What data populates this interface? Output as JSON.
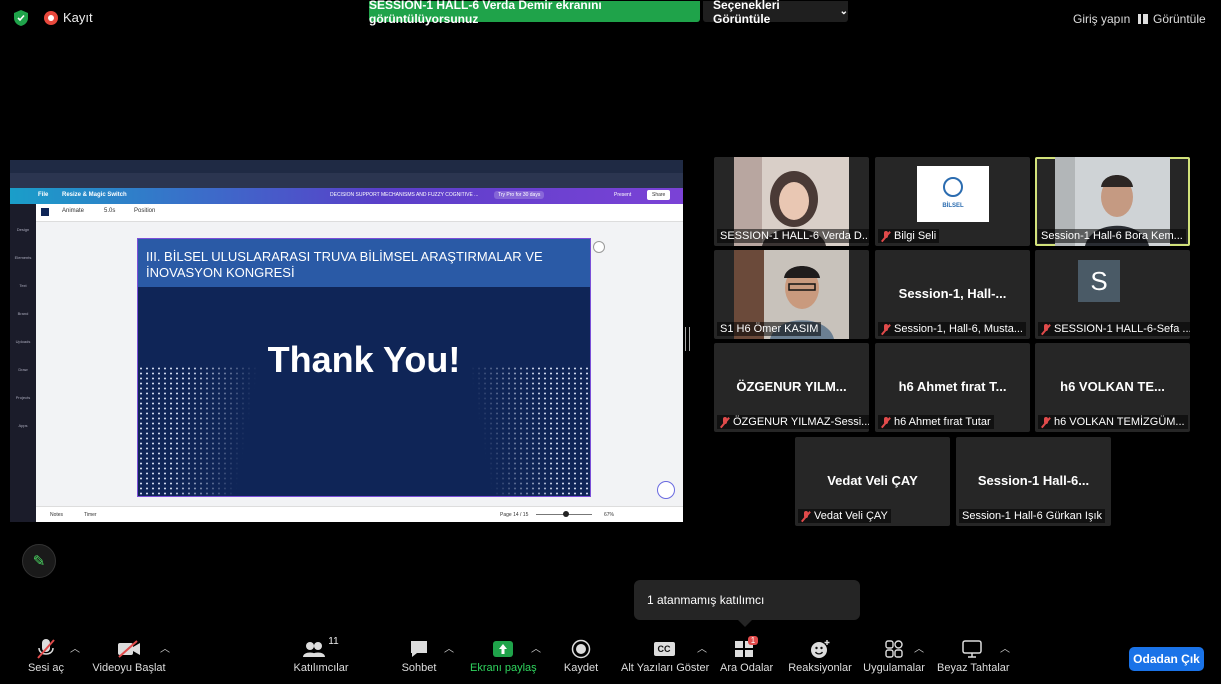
{
  "top": {
    "recording_label": "Kayıt",
    "share_banner": "SESSION-1 HALL-6 Verda Demir ekranını görüntülüyorsunuz",
    "view_options": "Seçenekleri Görüntüle",
    "sign_in": "Giriş yapın",
    "view": "Görüntüle"
  },
  "shared_screen": {
    "doc_title": "DECISION SUPPORT MECHANISMS AND FUZZY COGNITIVE ...",
    "try_pro": "Try Pro for 30 days",
    "present": "Present",
    "share": "Share",
    "file": "File",
    "resize": "Resize & Magic Switch",
    "animate": "Animate",
    "duration": "5.0s",
    "position": "Position",
    "slide_title": "III. BİLSEL ULUSLARARASI TRUVA BİLİMSEL ARAŞTIRMALAR VE İNOVASYON KONGRESİ",
    "slide_text": "Thank You!",
    "notes": "Notes",
    "timer": "Timer",
    "page": "Page 14 / 15",
    "zoom": "67%",
    "sidebar": [
      "Design",
      "Elements",
      "Text",
      "Brand",
      "Uploads",
      "Draw",
      "Projects",
      "Apps"
    ]
  },
  "tiles": [
    {
      "name": "SESSION-1 HALL-6 Verda D...",
      "center": "",
      "muted": false
    },
    {
      "name": "Bilgi Seli",
      "center": "",
      "muted": true,
      "logo_text": "BİLSEL"
    },
    {
      "name": "Session-1 Hall-6 Bora Kem...",
      "center": "",
      "muted": false
    },
    {
      "name": "S1 H6 Ömer KASIM",
      "center": "",
      "muted": false
    },
    {
      "name": "Session-1, Hall-6, Musta...",
      "center": "Session-1,  Hall-...",
      "muted": true
    },
    {
      "name": "SESSION-1 HALL-6-Sefa ...",
      "center": "S",
      "muted": true
    },
    {
      "name": "ÖZGENUR YILMAZ-Sessi...",
      "center": "ÖZGENUR  YILM...",
      "muted": true
    },
    {
      "name": "h6 Ahmet fırat Tutar",
      "center": "h6 Ahmet fırat T...",
      "muted": true
    },
    {
      "name": "h6 VOLKAN TEMİZGÜM...",
      "center": "h6 VOLKAN TE...",
      "muted": true
    },
    {
      "name": "Vedat Veli ÇAY",
      "center": "Vedat Veli ÇAY",
      "muted": true
    },
    {
      "name": "Session-1 Hall-6 Gürkan Işık",
      "center": "Session-1  Hall-6...",
      "muted": false
    }
  ],
  "popup": "1 atanmamış katılımcı",
  "toolbar": {
    "unmute": "Sesi aç",
    "start_video": "Videoyu Başlat",
    "participants": "Katılımcılar",
    "participants_count": "11",
    "chat": "Sohbet",
    "share_screen": "Ekranı paylaş",
    "record": "Kaydet",
    "captions": "Alt Yazıları Göster",
    "breakout": "Ara Odalar",
    "breakout_badge": "1",
    "reactions": "Reaksiyonlar",
    "apps": "Uygulamalar",
    "whiteboards": "Beyaz Tahtalar",
    "leave": "Odadan Çık"
  },
  "colors": {
    "share_green": "#1fa34a",
    "leave_blue": "#1a73e8",
    "mute_red": "#e14b4b",
    "active_speaker": "#d2e27a"
  }
}
